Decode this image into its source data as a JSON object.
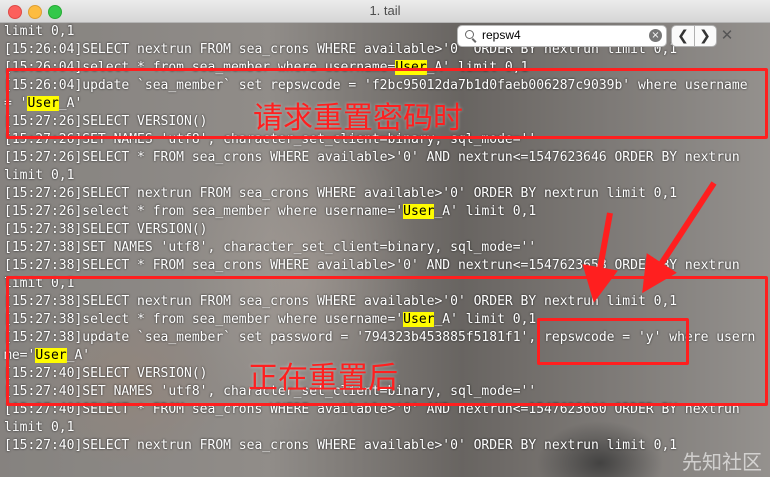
{
  "window": {
    "title": "1. tail"
  },
  "find_bar": {
    "query": "repsw4",
    "clear_glyph": "⊗",
    "prev_glyph": "❮",
    "next_glyph": "❯",
    "close_glyph": "✕"
  },
  "log_lines": [
    [
      {
        "t": "limit 0,1"
      }
    ],
    [
      {
        "t": "[15:26:04]SELECT nextrun FROM sea_crons WHERE available>'0' ORDER BY nextrun limit 0,1"
      }
    ],
    [
      {
        "t": "[15:26:04]select * from sea_member where username="
      },
      {
        "t": "User",
        "hl": true
      },
      {
        "t": "_A' limit 0,1"
      }
    ],
    [
      {
        "t": "[15:26:04]update `sea_member` set repswcode = 'f2bc95012da7b1d0faeb006287c9039b' where username"
      }
    ],
    [
      {
        "t": "= '"
      },
      {
        "t": "User",
        "hl": true
      },
      {
        "t": "_A'"
      }
    ],
    [
      {
        "t": "[15:27:26]SELECT VERSION()"
      }
    ],
    [
      {
        "t": "[15:27:26]SET NAMES 'utf8', character_set_client=binary, sql_mode=''"
      }
    ],
    [
      {
        "t": "[15:27:26]SELECT * FROM sea_crons WHERE available>'0' AND nextrun<=1547623646 ORDER BY nextrun"
      }
    ],
    [
      {
        "t": "limit 0,1"
      }
    ],
    [
      {
        "t": "[15:27:26]SELECT nextrun FROM sea_crons WHERE available>'0' ORDER BY nextrun limit 0,1"
      }
    ],
    [
      {
        "t": "[15:27:26]select * from sea_member where username='"
      },
      {
        "t": "User",
        "hl": true
      },
      {
        "t": "_A' limit 0,1"
      }
    ],
    [
      {
        "t": "[15:27:38]SELECT VERSION()"
      }
    ],
    [
      {
        "t": "[15:27:38]SET NAMES 'utf8', character_set_client=binary, sql_mode=''"
      }
    ],
    [
      {
        "t": "[15:27:38]SELECT * FROM sea_crons WHERE available>'0' AND nextrun<=1547623658 ORDER BY nextrun"
      }
    ],
    [
      {
        "t": "limit 0,1"
      }
    ],
    [
      {
        "t": "[15:27:38]SELECT nextrun FROM sea_crons WHERE available>'0' ORDER BY nextrun limit 0,1"
      }
    ],
    [
      {
        "t": "[15:27:38]select * from sea_member where username='"
      },
      {
        "t": "User",
        "hl": true
      },
      {
        "t": "_A' limit 0,1"
      }
    ],
    [
      {
        "t": "[15:27:38]update `sea_member` set password = '794323b453885f5181f1', repswcode = 'y' where usern"
      }
    ],
    [
      {
        "t": "me='"
      },
      {
        "t": "User",
        "hl": true
      },
      {
        "t": "_A'"
      }
    ],
    [
      {
        "t": "[15:27:40]SELECT VERSION()"
      }
    ],
    [
      {
        "t": "[15:27:40]SET NAMES 'utf8', character_set_client=binary, sql_mode=''"
      }
    ],
    [
      {
        "t": "[15:27:40]SELECT * FROM sea_crons WHERE available>'0' AND nextrun<=1547623660 ORDER BY nextrun"
      }
    ],
    [
      {
        "t": "limit 0,1"
      }
    ],
    [
      {
        "t": "[15:27:40]SELECT nextrun FROM sea_crons WHERE available>'0' ORDER BY nextrun limit 0,1"
      }
    ]
  ],
  "annotations": {
    "request_label": "请求重置密码时",
    "resetting_label": "正在重置后",
    "color": "#ff1f1f"
  },
  "watermark": "先知社区"
}
